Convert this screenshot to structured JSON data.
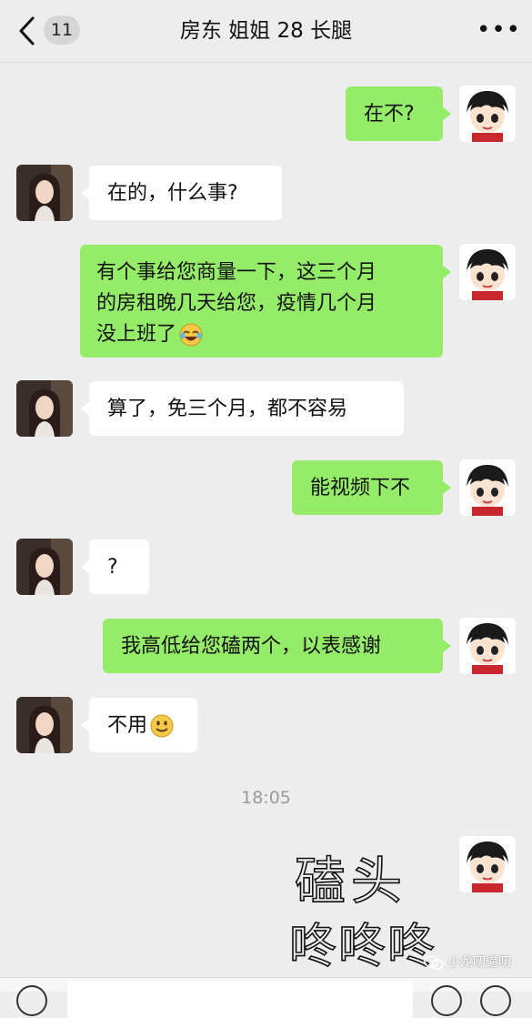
{
  "header": {
    "back_badge": "11",
    "title": "房东 姐姐 28 长腿",
    "more_label": "•••"
  },
  "messages": [
    {
      "from": "me",
      "text": "在不?"
    },
    {
      "from": "other",
      "text": "在的，什么事?"
    },
    {
      "from": "me",
      "lines": [
        "有个事给您商量一下，这三个月",
        "的房租晚几天给您，疫情几个月",
        "没上班了"
      ],
      "emoji": "crying-laughing-emoji"
    },
    {
      "from": "other",
      "text": "算了，免三个月，都不容易"
    },
    {
      "from": "me",
      "text": "能视频下不"
    },
    {
      "from": "other",
      "text": "?"
    },
    {
      "from": "me",
      "text": "我高低给您磕两个，以表感谢"
    },
    {
      "from": "other",
      "text": "不用",
      "emoji": "smile-emoji"
    }
  ],
  "timestamp": "18:05",
  "handwritten_sticker": {
    "line1": "磕头",
    "line2": "咚咚咚"
  },
  "watermark": "小龙叨逼叨",
  "colors": {
    "background": "#ededed",
    "my_bubble": "#95ec69",
    "other_bubble": "#ffffff"
  }
}
